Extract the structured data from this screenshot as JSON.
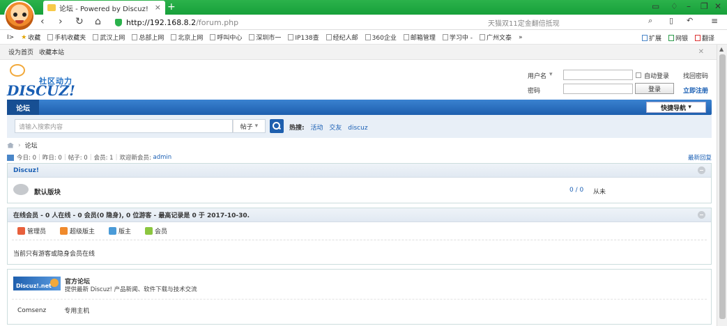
{
  "browser": {
    "tab_title": "论坛 - Powered by Discuz!",
    "address_host": "http://192.168.8.2",
    "address_path": "/forum.php",
    "search_placeholder": "天猫双11定金翻倍抵现",
    "bookmarks": [
      "收藏",
      "手机收藏夹",
      "武汉上网",
      "总部上网",
      "北京上网",
      "呼叫中心",
      "深圳市一",
      "IP138查",
      "经纪人邮",
      "360企业",
      "邮箱管理",
      "学习中 -",
      "广州文泰"
    ],
    "bookmarks_more": "»",
    "ext_items": [
      "扩展",
      "网银",
      "翻译"
    ]
  },
  "topbar": {
    "set_home": "设为首页",
    "bookmark": "收藏本站"
  },
  "logo": {
    "cn": "社区动力",
    "en": "DISCUZ!"
  },
  "login": {
    "username_label": "用户名",
    "password_label": "密码",
    "auto_login": "自动登录",
    "find_password": "找回密码",
    "submit": "登录",
    "register": "立即注册"
  },
  "nav": {
    "forum": "论坛",
    "quick": "快捷导航"
  },
  "search": {
    "placeholder": "请输入搜索内容",
    "type": "帖子",
    "hot_label": "热搜:",
    "hot_words": [
      "活动",
      "交友",
      "discuz"
    ]
  },
  "breadcrumb": {
    "current": "论坛"
  },
  "stats": {
    "today": "今日: 0",
    "yesterday": "昨日: 0",
    "posts": "帖子: 0",
    "members": "会员: 1",
    "welcome": "欢迎新会员:",
    "newest": "admin",
    "latest_reply": "最新回复"
  },
  "category": {
    "title": "Discuz!",
    "forum_name": "默认版块",
    "counts": "0 / 0",
    "last_post": "从未"
  },
  "online": {
    "title": "在线会员 - 0 人在线 - 0 会员(0 隐身), 0 位游客 - 最高记录是 0 于 2017-10-30.",
    "legend": [
      {
        "label": "管理员",
        "color": "#e8603c"
      },
      {
        "label": "超级版主",
        "color": "#f08a2c"
      },
      {
        "label": "版主",
        "color": "#4a9bd8"
      },
      {
        "label": "会员",
        "color": "#8cc63f"
      }
    ],
    "message": "当前只有游客或隐身会员在线"
  },
  "links": {
    "banner_text": "Discuz!.net",
    "title": "官方论坛",
    "desc": "提供最新 Discuz! 产品新闻、软件下载与技术交流",
    "text_links": [
      "Comsenz",
      "专用主机"
    ]
  }
}
